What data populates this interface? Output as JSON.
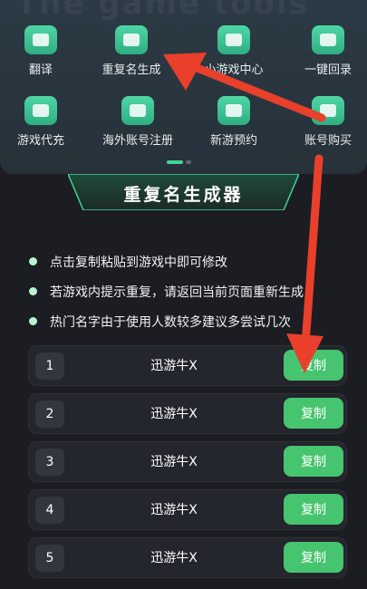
{
  "banner_text": "The game tools",
  "tools": [
    {
      "label": "翻译",
      "icon": "translate-icon"
    },
    {
      "label": "重复名生成",
      "icon": "id-card-icon"
    },
    {
      "label": "小游戏中心",
      "icon": "ghost-icon"
    },
    {
      "label": "一键回录",
      "icon": "video-camera-icon"
    },
    {
      "label": "游戏代充",
      "icon": "gamepad-icon"
    },
    {
      "label": "海外账号注册",
      "icon": "user-card-icon"
    },
    {
      "label": "新游预约",
      "icon": "calendar-clock-icon"
    },
    {
      "label": "账号购买",
      "icon": "user-card-icon"
    }
  ],
  "page_title": "重复名生成器",
  "tips": [
    "点击复制粘贴到游戏中即可修改",
    "若游戏内提示重复，请返回当前页面重新生成",
    "热门名字由于使用人数较多建议多尝试几次"
  ],
  "names": [
    {
      "index": "1",
      "name": "迅游牛X",
      "copy_label": "复制"
    },
    {
      "index": "2",
      "name": "迅游牛X",
      "copy_label": "复制"
    },
    {
      "index": "3",
      "name": "迅游牛X",
      "copy_label": "复制"
    },
    {
      "index": "4",
      "name": "迅游牛X",
      "copy_label": "复制"
    },
    {
      "index": "5",
      "name": "迅游牛X",
      "copy_label": "复制"
    }
  ],
  "colors": {
    "accent": "#47c46f",
    "arrow": "#e8402b",
    "panel": "#2b3a44"
  }
}
